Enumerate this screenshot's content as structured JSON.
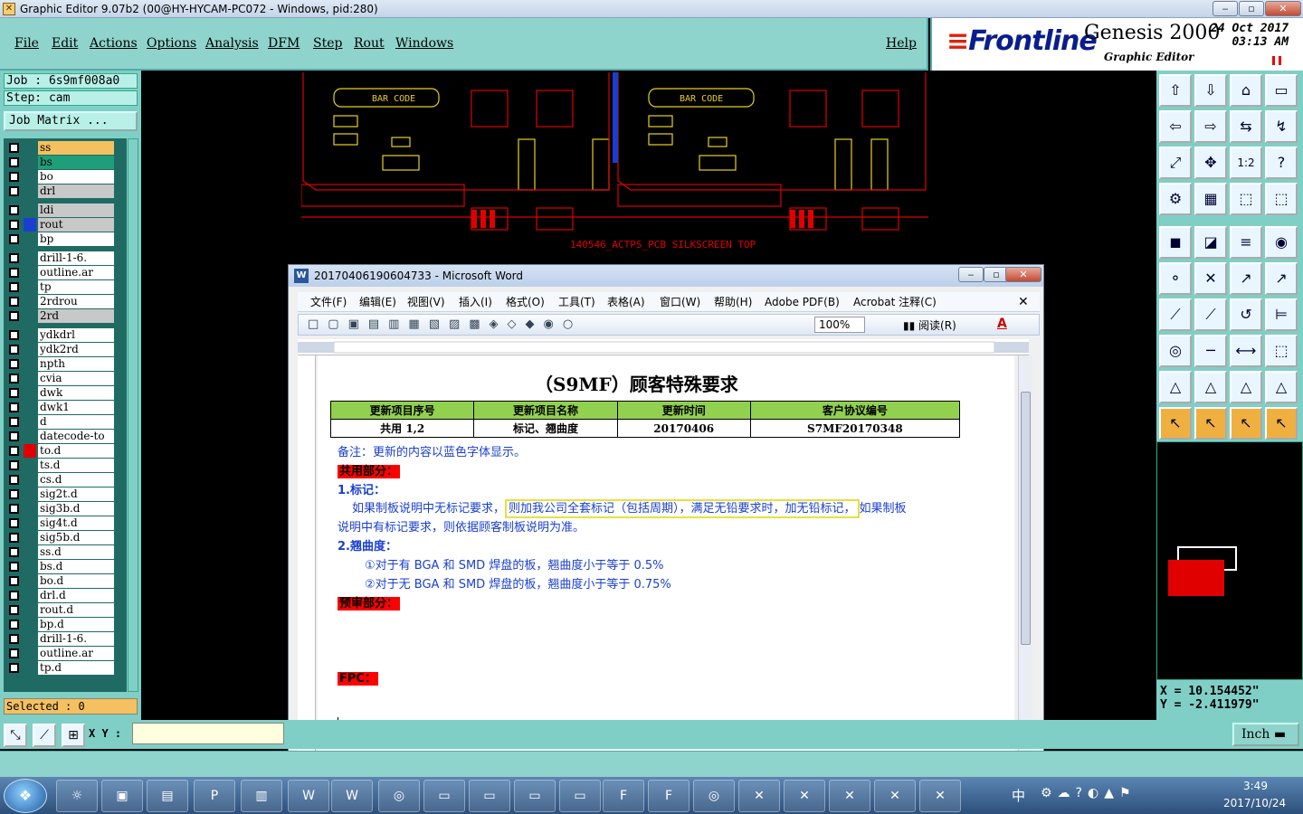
{
  "window": {
    "title": "Graphic Editor 9.07b2 (00@HY-HYCAM-PC072 - Windows, pid:280)"
  },
  "menu": {
    "file": "File",
    "edit": "Edit",
    "actions": "Actions",
    "options": "Options",
    "analysis": "Analysis",
    "dfm": "DFM",
    "step": "Step",
    "rout": "Rout",
    "windows": "Windows",
    "help": "Help"
  },
  "brand": {
    "name": "Frontline",
    "product": "Genesis 2000",
    "subtitle": "Graphic Editor",
    "date": "24 Oct 2017",
    "time": "03:13 AM"
  },
  "job": {
    "job": "Job  : 6s9mf008a0",
    "step": "Step: cam",
    "matrix": "Job Matrix ..."
  },
  "layers": [
    {
      "n": "ss",
      "c": "#f5c060"
    },
    {
      "n": "bs",
      "c": "#1f9e7a"
    },
    {
      "n": "bo",
      "c": "#fff"
    },
    {
      "n": "drl",
      "c": "#c8c8c8"
    },
    {
      "n": "ldi",
      "c": "#c8c8c8"
    },
    {
      "n": "rout",
      "c": "#c8c8c8"
    },
    {
      "n": "bp",
      "c": "#fff"
    },
    {
      "n": "drill-1-6.",
      "c": "#fff"
    },
    {
      "n": "outline.ar",
      "c": "#fff"
    },
    {
      "n": "tp",
      "c": "#fff"
    },
    {
      "n": "2rdrou",
      "c": "#fff"
    },
    {
      "n": "2rd",
      "c": "#c8c8c8"
    },
    {
      "n": "ydkdrl",
      "c": "#fff"
    },
    {
      "n": "ydk2rd",
      "c": "#fff"
    },
    {
      "n": "npth",
      "c": "#fff"
    },
    {
      "n": "cvia",
      "c": "#fff"
    },
    {
      "n": "dwk",
      "c": "#fff"
    },
    {
      "n": "dwk1",
      "c": "#fff"
    },
    {
      "n": "d",
      "c": "#fff"
    },
    {
      "n": "datecode-to",
      "c": "#fff"
    },
    {
      "n": "to.d",
      "c": "#fff"
    },
    {
      "n": "ts.d",
      "c": "#fff"
    },
    {
      "n": "cs.d",
      "c": "#fff"
    },
    {
      "n": "sig2t.d",
      "c": "#fff"
    },
    {
      "n": "sig3b.d",
      "c": "#fff"
    },
    {
      "n": "sig4t.d",
      "c": "#fff"
    },
    {
      "n": "sig5b.d",
      "c": "#fff"
    },
    {
      "n": "ss.d",
      "c": "#fff"
    },
    {
      "n": "bs.d",
      "c": "#fff"
    },
    {
      "n": "bo.d",
      "c": "#fff"
    },
    {
      "n": "drl.d",
      "c": "#fff"
    },
    {
      "n": "rout.d",
      "c": "#fff"
    },
    {
      "n": "bp.d",
      "c": "#fff"
    },
    {
      "n": "drill-1-6.",
      "c": "#fff"
    },
    {
      "n": "outline.ar",
      "c": "#fff"
    },
    {
      "n": "tp.d",
      "c": "#fff"
    }
  ],
  "selected": "Selected : 0",
  "board": {
    "barcode1": "BAR CODE",
    "barcode2": "BAR CODE",
    "label": "140546_ACTPS_PCB SILKSCREEN TOP"
  },
  "coords": {
    "x": "X  = 10.154452\"",
    "y": "Y  = -2.411979\""
  },
  "bottom": {
    "xy": "X Y :",
    "unit": "Inch"
  },
  "word": {
    "title": "20170406190604733 - Microsoft Word",
    "menu": [
      "文件(F)",
      "编辑(E)",
      "视图(V)",
      "插入(I)",
      "格式(O)",
      "工具(T)",
      "表格(A)",
      "窗口(W)",
      "帮助(H)",
      "Adobe PDF(B)",
      "Acrobat 注释(C)"
    ],
    "zoom": "100%",
    "read": "阅读(R)",
    "doc": {
      "title": "（S9MF）顾客特殊要求",
      "headers": [
        "更新项目序号",
        "更新项目名称",
        "更新时间",
        "客户协议编号"
      ],
      "row": [
        "共用 1,2",
        "标记、翘曲度",
        "20170406",
        "S7MF20170348"
      ],
      "note": "备注：更新的内容以蓝色字体显示。",
      "common": "共用部分：",
      "mark_h": "1.标记：",
      "mark_a": "如果制板说明中无标记要求，",
      "mark_b": "则加我公司全套标记（包括周期），满足无铅要求时，加无铅标记，",
      "mark_c": "如果制板",
      "mark_d": "说明中有标记要求，则依据顾客制板说明为准。",
      "warp_h": "2.翘曲度：",
      "warp_1": "①对于有 BGA 和 SMD 焊盘的板，翘曲度小于等于 0.5%",
      "warp_2": "②对于无 BGA 和 SMD 焊盘的板，翘曲度小于等于 0.75%",
      "pre": "预审部分：",
      "fpc": "FPC："
    }
  },
  "tray": {
    "time": "3:49",
    "date": "2017/10/24",
    "ime": "中"
  }
}
